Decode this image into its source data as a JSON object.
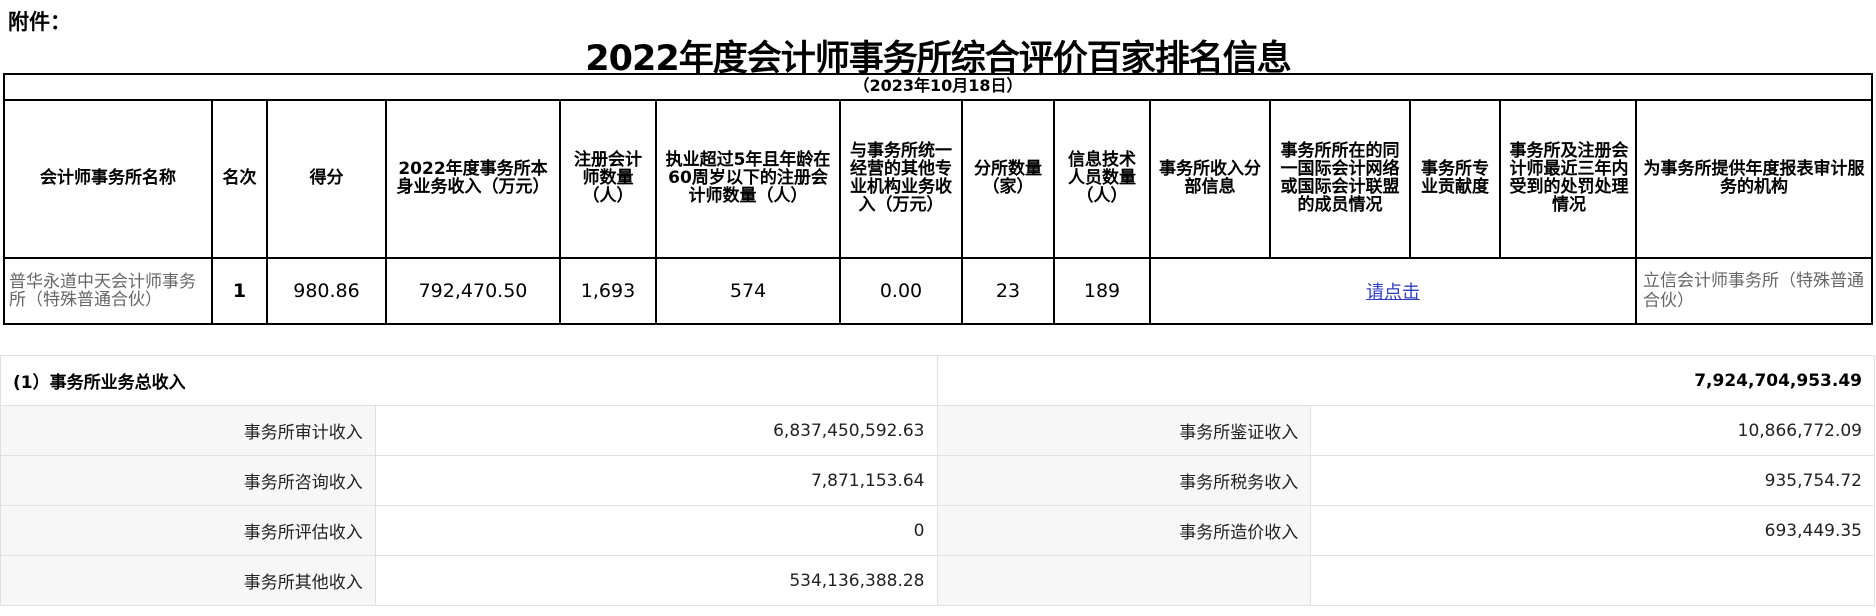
{
  "attachment_label": "附件：",
  "title": "2022年度会计师事务所综合评价百家排名信息",
  "date_note": "（2023年10月18日）",
  "rank_table": {
    "headers": {
      "name": "会计师事务所名称",
      "rank": "名次",
      "score": "得分",
      "revenue": "2022年度事务所本身业务收入（万元）",
      "cpa_count": "注册会计师数量（人）",
      "cpa_5yr": "执业超过5年且年龄在60周岁以下的注册会计师数量（人）",
      "other_revenue": "与事务所统一经营的其他专业机构业务收入（万元）",
      "branches": "分所数量（家）",
      "it_staff": "信息技术人员数量（人）",
      "branch_income": "事务所收入分部信息",
      "intl_network": "事务所所在的同一国际会计网络或国际会计联盟的成员情况",
      "contribution": "事务所专业贡献度",
      "penalties": "事务所及注册会计师最近三年内受到的处罚处理情况",
      "auditor": "为事务所提供年度报表审计服务的机构"
    },
    "row": {
      "name": "普华永道中天会计师事务所（特殊普通合伙）",
      "rank": "1",
      "score": "980.86",
      "revenue": "792,470.50",
      "cpa_count": "1,693",
      "cpa_5yr": "574",
      "other_revenue": "0.00",
      "branches": "23",
      "it_staff": "189",
      "link_text": "请点击",
      "auditor": "立信会计师事务所（特殊普通合伙）"
    }
  },
  "income": {
    "total_label": "(1）事务所业务总收入",
    "total_value": "7,924,704,953.49",
    "rows": [
      {
        "l1": "事务所审计收入",
        "v1": "6,837,450,592.63",
        "l2": "事务所鉴证收入",
        "v2": "10,866,772.09"
      },
      {
        "l1": "事务所咨询收入",
        "v1": "7,871,153.64",
        "l2": "事务所税务收入",
        "v2": "935,754.72"
      },
      {
        "l1": "事务所评估收入",
        "v1": "0",
        "l2": "事务所造价收入",
        "v2": "693,449.35"
      },
      {
        "l1": "事务所其他收入",
        "v1": "534,136,388.28",
        "l2": "",
        "v2": ""
      }
    ]
  }
}
